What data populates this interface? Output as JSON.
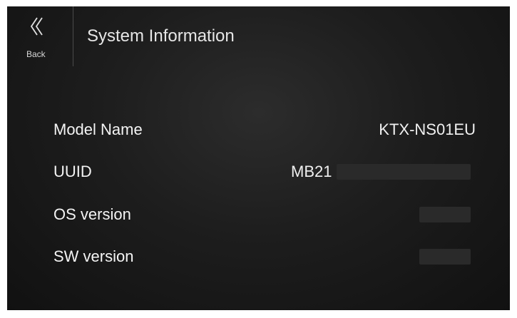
{
  "header": {
    "back_label": "Back",
    "title": "System Information"
  },
  "icons": {
    "back": "double-chevron-left-icon"
  },
  "info": {
    "model_name": {
      "label": "Model Name",
      "value": "KTX-NS01EU"
    },
    "uuid": {
      "label": "UUID",
      "value": "MB21"
    },
    "os_version": {
      "label": "OS version"
    },
    "sw_version": {
      "label": "SW version"
    }
  },
  "colors": {
    "background": "#1d1d1d",
    "text": "#f2f2f2",
    "divider": "#4a4a4a"
  }
}
